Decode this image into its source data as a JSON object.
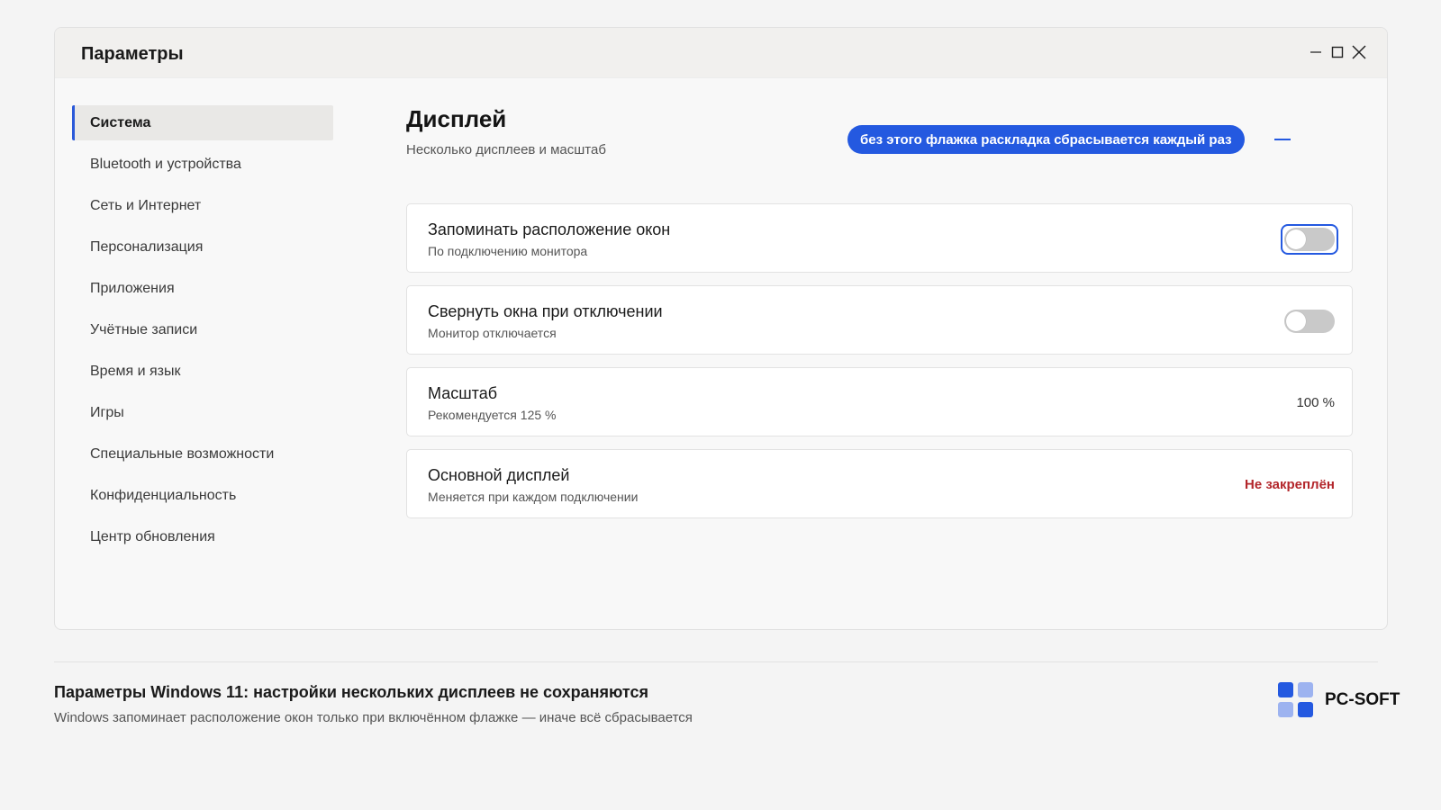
{
  "window": {
    "title": "Параметры",
    "controls": [
      "minimize-icon",
      "maximize-icon",
      "close-icon"
    ]
  },
  "sidebar": {
    "items": [
      {
        "label": "Система",
        "active": true
      },
      {
        "label": "Bluetooth и устройства",
        "active": false
      },
      {
        "label": "Сеть и Интернет",
        "active": false
      },
      {
        "label": "Персонализация",
        "active": false
      },
      {
        "label": "Приложения",
        "active": false
      },
      {
        "label": "Учётные записи",
        "active": false
      },
      {
        "label": "Время и язык",
        "active": false
      },
      {
        "label": "Игры",
        "active": false
      },
      {
        "label": "Специальные возможности",
        "active": false
      },
      {
        "label": "Конфиденциальность",
        "active": false
      },
      {
        "label": "Центр обновления",
        "active": false
      }
    ]
  },
  "main": {
    "heading": "Дисплей",
    "subheading": "Несколько дисплеев и масштаб",
    "callout": "без этого флажка раскладка сбрасывается каждый раз",
    "cards": [
      {
        "title": "Запоминать расположение окон",
        "subtitle": "По подключению монитора",
        "toggle": false
      },
      {
        "title": "Свернуть окна при отключении",
        "subtitle": "Монитор отключается",
        "toggle": false
      },
      {
        "title": "Масштаб",
        "subtitle": "Рекомендуется 125 %",
        "value": "100 %"
      },
      {
        "title": "Основной дисплей",
        "subtitle": "Меняется при каждом подключении",
        "value": "Не закреплён"
      }
    ]
  },
  "footer": {
    "title": "Параметры Windows 11: настройки нескольких дисплеев не сохраняются",
    "subtitle": "Windows запоминает расположение окон только при включённом флажке — иначе всё сбрасывается",
    "brand": "PC-SOFT"
  },
  "colors": {
    "accent": "#2459e0",
    "warning": "#b3262b",
    "brand_dark": "#2459e0",
    "brand_light": "#9db3f0"
  }
}
